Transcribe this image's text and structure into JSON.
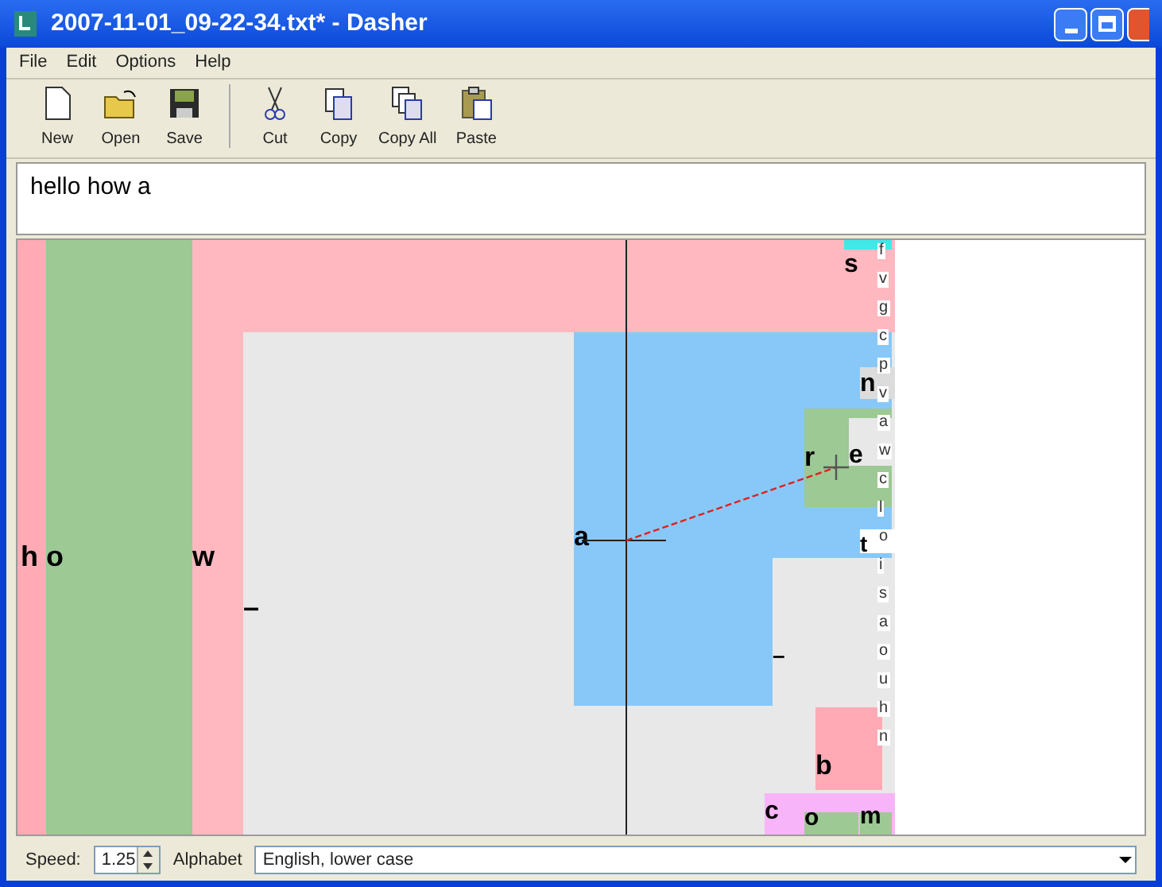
{
  "window": {
    "title": "2007-11-01_09-22-34.txt* - Dasher"
  },
  "menu": [
    "File",
    "Edit",
    "Options",
    "Help"
  ],
  "toolbar": [
    {
      "label": "New",
      "kind": "new"
    },
    {
      "label": "Open",
      "kind": "open"
    },
    {
      "label": "Save",
      "kind": "save"
    },
    {
      "label": "Cut",
      "kind": "cut"
    },
    {
      "label": "Copy",
      "kind": "copy"
    },
    {
      "label": "Copy All",
      "kind": "copyall"
    },
    {
      "label": "Paste",
      "kind": "paste"
    }
  ],
  "editor": {
    "value": "hello how a"
  },
  "canvas": {
    "boxes": [
      {
        "letter": "h",
        "color": "#ffaab4"
      },
      {
        "letter": "o",
        "color": "#9cc994"
      },
      {
        "letter": "w",
        "color": "#ffb8c0"
      },
      {
        "letter": "–",
        "color": "#e8e8e8"
      },
      {
        "letter": "a",
        "color": "#88c8f8"
      },
      {
        "letter": "–",
        "color": "#e8e8e8"
      },
      {
        "letter": "s",
        "color": "#40e8e8"
      },
      {
        "letter": "n",
        "color": "#dcdcdc"
      },
      {
        "letter": "r",
        "color": "#9cc994"
      },
      {
        "letter": "e",
        "color": "#e8e8e8"
      },
      {
        "letter": "t",
        "color": "#ffffff"
      },
      {
        "letter": "b",
        "color": "#ffaab4"
      },
      {
        "letter": "c",
        "color": "#f8b4f8"
      },
      {
        "letter": "o",
        "color": "#9cc994"
      },
      {
        "letter": "m",
        "color": "#9cc994"
      }
    ],
    "small_letters": [
      "f",
      "v",
      "g",
      "c",
      "p",
      "v",
      "a",
      "w",
      "c",
      "l",
      "o",
      "i",
      "s",
      "a",
      "o",
      "u",
      "h",
      "n"
    ]
  },
  "status": {
    "speed_label": "Speed:",
    "speed": "1.25",
    "alphabet_label": "Alphabet",
    "alphabet": "English, lower case"
  }
}
